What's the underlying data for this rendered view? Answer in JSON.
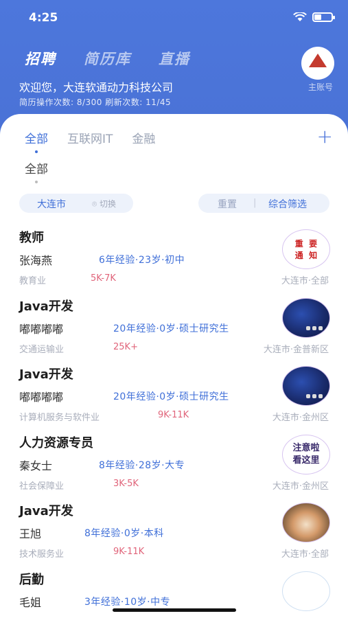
{
  "status": {
    "time": "4:25"
  },
  "header": {
    "tabs": [
      "招聘",
      "简历库",
      "直播"
    ],
    "active_tab": 0,
    "welcome": "欢迎您，大连软通动力科技公司",
    "stats": "简历操作次数: 8/300  刷新次数: 11/45",
    "main_account": "主账号"
  },
  "categories": [
    "全部",
    "互联网IT",
    "金融"
  ],
  "subcategory": "全部",
  "filters": {
    "city": "大连市",
    "switch": "切换",
    "reset": "重置",
    "separator": "|",
    "combo": "综合筛选"
  },
  "candidates": [
    {
      "job": "教师",
      "name": "张海燕",
      "meta": "6年经验·23岁·初中",
      "industry": "教育业",
      "salary": "5K-7K",
      "location": "大连市·全部",
      "thumb": "sign-image"
    },
    {
      "job": "Java开发",
      "name": "嘟嘟嘟嘟",
      "meta": "20年经验·0岁·硕士研究生",
      "industry": "交通运输业",
      "salary": "25K+",
      "location": "大连市·金普新区",
      "thumb": "phone-wallpaper"
    },
    {
      "job": "Java开发",
      "name": "嘟嘟嘟嘟",
      "meta": "20年经验·0岁·硕士研究生",
      "industry": "计算机服务与软件业",
      "salary": "9K-11K",
      "location": "大连市·金州区",
      "thumb": "phone-wallpaper"
    },
    {
      "job": "人力资源专员",
      "name": "秦女士",
      "meta": "8年经验·28岁·大专",
      "industry": "社会保障业",
      "salary": "3K-5K",
      "location": "大连市·金州区",
      "thumb": "notice-image"
    },
    {
      "job": "Java开发",
      "name": "王旭",
      "meta": "8年经验·0岁·本科",
      "industry": "技术服务业",
      "salary": "9K-11K",
      "location": "大连市·全部",
      "thumb": "cat-photo"
    },
    {
      "job": "后勤",
      "name": "毛姐",
      "meta": "3年经验·10岁·中专",
      "industry": "",
      "salary": "",
      "location": "",
      "thumb": "empty"
    }
  ],
  "thumb_text": {
    "sign": [
      "重",
      "要",
      "通",
      "知"
    ],
    "notice": [
      "注意啦",
      "看这里"
    ]
  }
}
